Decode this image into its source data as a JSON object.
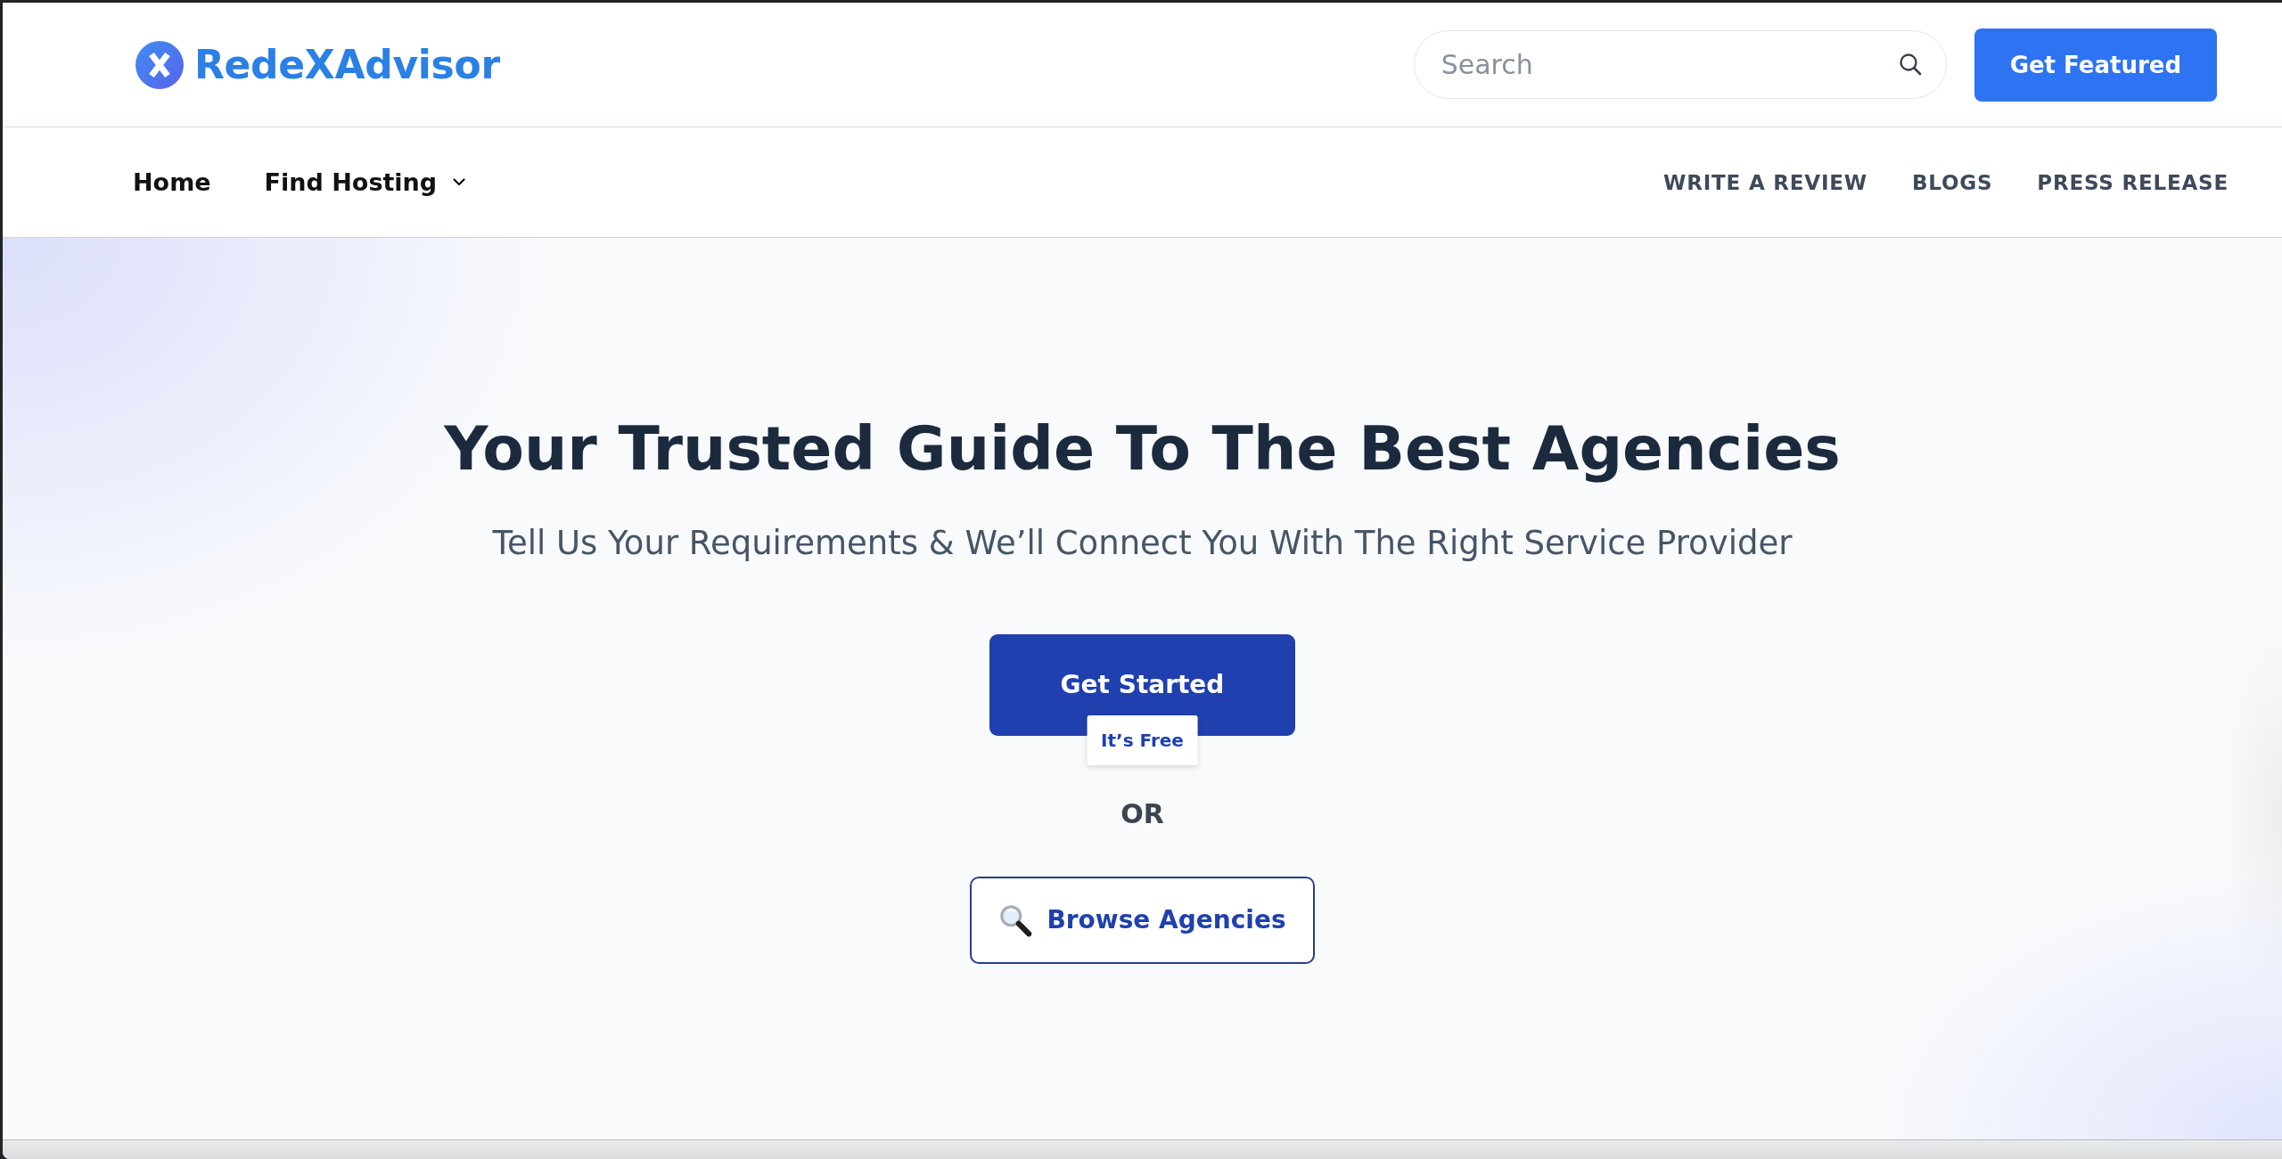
{
  "header": {
    "logo": {
      "text": "RedeXAdvisor"
    },
    "search": {
      "placeholder": "Search"
    },
    "cta_button": {
      "label": "Get Featured"
    }
  },
  "nav": {
    "left_items": [
      {
        "label": "Home",
        "has_dropdown": false
      },
      {
        "label": "Find Hosting",
        "has_dropdown": true
      }
    ],
    "right_items": [
      {
        "label": "WRITE A REVIEW"
      },
      {
        "label": "BLOGS"
      },
      {
        "label": "PRESS RELEASE"
      }
    ]
  },
  "hero": {
    "title": "Your Trusted Guide To The Best Agencies",
    "subtitle": "Tell Us Your Requirements & We’ll Connect You With The Right Service Provider",
    "primary_button": {
      "label": "Get Started",
      "badge": "It’s Free"
    },
    "divider_text": "OR",
    "secondary_button": {
      "label": "Browse Agencies"
    }
  }
}
